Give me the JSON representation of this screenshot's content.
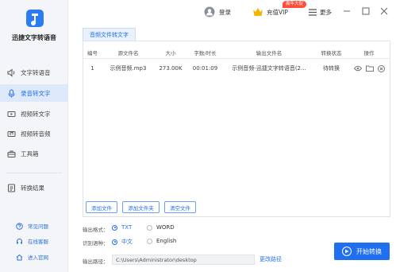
{
  "app": {
    "name": "迅捷文字转语音"
  },
  "sidebar": {
    "items": [
      {
        "label": "文字转语音",
        "icon": "speaker-icon"
      },
      {
        "label": "录音转文字",
        "icon": "microphone-icon",
        "active": true
      },
      {
        "label": "视频转文字",
        "icon": "video-icon"
      },
      {
        "label": "视频转音频",
        "icon": "video-audio-icon"
      },
      {
        "label": "工具箱",
        "icon": "toolbox-icon"
      }
    ],
    "results": {
      "label": "转换结果",
      "icon": "results-icon"
    },
    "links": [
      {
        "label": "常见问题",
        "icon": "question-icon"
      },
      {
        "label": "在线客服",
        "icon": "headset-icon"
      },
      {
        "label": "进入官网",
        "icon": "home-icon"
      }
    ]
  },
  "topbar": {
    "login": "登录",
    "vip_badge": "周年大促",
    "vip": "充值VIP",
    "more": "更多"
  },
  "tab": {
    "label": "音频文件转文字"
  },
  "table": {
    "columns": [
      "编号",
      "源文件名",
      "大小",
      "字数/时长",
      "输出文件名",
      "转换状态",
      "操作"
    ],
    "rows": [
      {
        "index": "1",
        "source": "示例音频.mp3",
        "size": "273.00K",
        "duration": "00:01:09",
        "output": "示例音频-迅捷文字转语音(2...",
        "status": "待转换"
      }
    ]
  },
  "buttons": {
    "add_file": "添加文件",
    "add_folder": "添加文件夹",
    "clear": "清空文件"
  },
  "output_format": {
    "label": "输出格式：",
    "options": [
      "TXT",
      "WORD"
    ],
    "selected": "TXT"
  },
  "language": {
    "label": "识别语种：",
    "options": [
      "中文",
      "English"
    ],
    "selected": "中文"
  },
  "output_path": {
    "label": "输出路径：",
    "value": "C:\\Users\\Administrator\\desktop",
    "change": "更改路径"
  },
  "convert": {
    "label": "开始转换"
  },
  "colors": {
    "accent": "#1f6ff0",
    "sidebar_bg": "#f3f5f9",
    "vip_badge": "#ff4d3b"
  }
}
